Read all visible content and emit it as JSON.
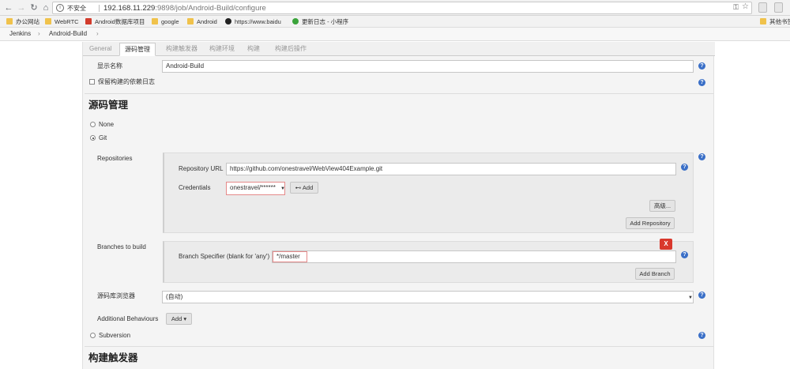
{
  "browser": {
    "insecure_label": "不安全",
    "url_host": "192.168.11.229",
    "url_path": ":9898/job/Android-Build/configure"
  },
  "bookmarks": [
    {
      "label": "办公网站",
      "icon": "folder-icon"
    },
    {
      "label": "WebRTC",
      "icon": "folder-icon"
    },
    {
      "label": "Android数据库项目",
      "icon": "red-app-icon"
    },
    {
      "label": "google",
      "icon": "folder-icon"
    },
    {
      "label": "Android",
      "icon": "folder-icon"
    },
    {
      "label": "https://www.baidu",
      "icon": "github-icon"
    },
    {
      "label": "更新日志 - 小程序",
      "icon": "wechat-icon"
    },
    {
      "label": "其他书签",
      "icon": "folder-icon"
    }
  ],
  "breadcrumb": {
    "root": "Jenkins",
    "job": "Android-Build",
    "sep": "›"
  },
  "tabs": [
    "General",
    "源码管理",
    "构建触发器",
    "构建环境",
    "构建",
    "构建后操作"
  ],
  "general": {
    "display_name_label": "显示名称",
    "display_name_value": "Android-Build",
    "keep_deps_label": "保留构建的依赖日志"
  },
  "scm": {
    "title": "源码管理",
    "none_label": "None",
    "git_label": "Git",
    "repositories_label": "Repositories",
    "repo_url_label": "Repository URL",
    "repo_url_value": "https://github.com/onestravel/WebView404Example.git",
    "credentials_label": "Credentials",
    "credentials_value": "onestravel/******",
    "add_cred_label": "Add",
    "advanced_label": "高级...",
    "add_repo_label": "Add Repository",
    "branches_label": "Branches to build",
    "branch_spec_label": "Branch Specifier (blank for 'any')",
    "branch_spec_value": "*/master",
    "delete_label": "X",
    "add_branch_label": "Add Branch",
    "browser_label": "源码库浏览器",
    "browser_value": "(自动)",
    "behaviours_label": "Additional Behaviours",
    "add_behaviour_label": "Add",
    "subversion_label": "Subversion"
  },
  "triggers": {
    "title": "构建触发器"
  },
  "colors": {
    "help": "#3a6fc7",
    "delete": "#d9382c",
    "highlight": "#e58a8a"
  }
}
